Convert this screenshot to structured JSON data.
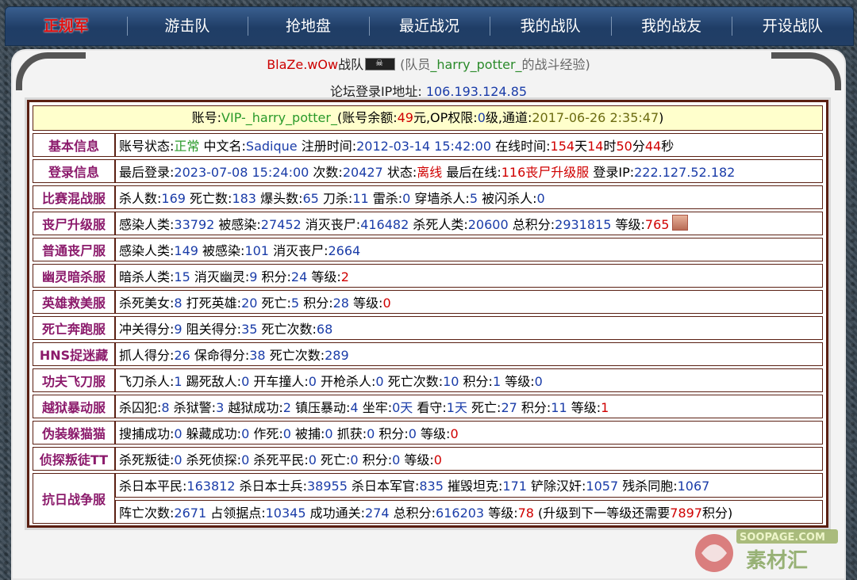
{
  "nav": {
    "items": [
      "正规军",
      "游击队",
      "抢地盘",
      "最近战况",
      "我的战队",
      "我的战友",
      "开设战队"
    ]
  },
  "header": {
    "team": "BlaZe.wOw",
    "team_suffix": "战队",
    "member_prefix": "(队员",
    "member": "_harry_potter_",
    "member_suffix": "的战斗经验)",
    "ip_label": "论坛登录IP地址:",
    "ip": "106.193.124.85"
  },
  "account": {
    "label": "账号:",
    "id": "VIP-_harry_potter_",
    "balance_label": "(账号余额:",
    "balance": "49",
    "balance_unit": "元,OP权限:",
    "op_level": "0",
    "op_unit": "级,通道:",
    "channel": "2017-06-26 2:35:47",
    "close": ")"
  },
  "rows": [
    {
      "label": "基本信息",
      "parts": [
        {
          "t": "账号状态:"
        },
        {
          "t": "正常",
          "c": "g"
        },
        {
          "t": " 中文名:"
        },
        {
          "t": "Sadique",
          "c": "b"
        },
        {
          "t": " 注册时间:"
        },
        {
          "t": "2012-03-14 15:42:00",
          "c": "b"
        },
        {
          "t": " 在线时间:"
        },
        {
          "t": "154",
          "c": "r"
        },
        {
          "t": "天"
        },
        {
          "t": "14",
          "c": "r"
        },
        {
          "t": "时"
        },
        {
          "t": "50",
          "c": "r"
        },
        {
          "t": "分"
        },
        {
          "t": "44",
          "c": "r"
        },
        {
          "t": "秒"
        }
      ]
    },
    {
      "label": "登录信息",
      "parts": [
        {
          "t": "最后登录:"
        },
        {
          "t": "2023-07-08 15:24:00",
          "c": "b"
        },
        {
          "t": " 次数:"
        },
        {
          "t": "20427",
          "c": "b"
        },
        {
          "t": " 状态:"
        },
        {
          "t": "离线",
          "c": "r"
        },
        {
          "t": " 最后在线:"
        },
        {
          "t": "116丧尸升级服",
          "c": "r"
        },
        {
          "t": " 登录IP:"
        },
        {
          "t": "222.127.52.182",
          "c": "b"
        }
      ]
    },
    {
      "label": "比赛混战服",
      "parts": [
        {
          "t": "杀人数:"
        },
        {
          "t": "169",
          "c": "b"
        },
        {
          "t": " 死亡数:"
        },
        {
          "t": "183",
          "c": "b"
        },
        {
          "t": " 爆头数:"
        },
        {
          "t": "65",
          "c": "b"
        },
        {
          "t": " 刀杀:"
        },
        {
          "t": "11",
          "c": "b"
        },
        {
          "t": " 雷杀:"
        },
        {
          "t": "0",
          "c": "b"
        },
        {
          "t": " 穿墙杀人:"
        },
        {
          "t": "5",
          "c": "b"
        },
        {
          "t": " 被闪杀人:"
        },
        {
          "t": "0",
          "c": "b"
        }
      ]
    },
    {
      "label": "丧尸升级服",
      "avatar": true,
      "parts": [
        {
          "t": "感染人类:"
        },
        {
          "t": "33792",
          "c": "b"
        },
        {
          "t": " 被感染:"
        },
        {
          "t": "27452",
          "c": "b"
        },
        {
          "t": " 消灭丧尸:"
        },
        {
          "t": "416482",
          "c": "b"
        },
        {
          "t": " 杀死人类:"
        },
        {
          "t": "20600",
          "c": "b"
        },
        {
          "t": " 总积分:"
        },
        {
          "t": "2931815",
          "c": "b"
        },
        {
          "t": " 等级:"
        },
        {
          "t": "765",
          "c": "r"
        }
      ]
    },
    {
      "label": "普通丧尸服",
      "parts": [
        {
          "t": "感染人类:"
        },
        {
          "t": "149",
          "c": "b"
        },
        {
          "t": " 被感染:"
        },
        {
          "t": "101",
          "c": "b"
        },
        {
          "t": " 消灭丧尸:"
        },
        {
          "t": "2664",
          "c": "b"
        }
      ]
    },
    {
      "label": "幽灵暗杀服",
      "parts": [
        {
          "t": "暗杀人类:"
        },
        {
          "t": "15",
          "c": "b"
        },
        {
          "t": " 消灭幽灵:"
        },
        {
          "t": "9",
          "c": "b"
        },
        {
          "t": " 积分:"
        },
        {
          "t": "24",
          "c": "b"
        },
        {
          "t": " 等级:"
        },
        {
          "t": "2",
          "c": "r"
        }
      ]
    },
    {
      "label": "英雄救美服",
      "parts": [
        {
          "t": "杀死美女:"
        },
        {
          "t": "8",
          "c": "b"
        },
        {
          "t": " 打死英雄:"
        },
        {
          "t": "20",
          "c": "b"
        },
        {
          "t": " 死亡:"
        },
        {
          "t": "5",
          "c": "b"
        },
        {
          "t": " 积分:"
        },
        {
          "t": "28",
          "c": "b"
        },
        {
          "t": " 等级:"
        },
        {
          "t": "0",
          "c": "r"
        }
      ]
    },
    {
      "label": "死亡奔跑服",
      "parts": [
        {
          "t": "冲关得分:"
        },
        {
          "t": "9",
          "c": "b"
        },
        {
          "t": " 阻关得分:"
        },
        {
          "t": "35",
          "c": "b"
        },
        {
          "t": " 死亡次数:"
        },
        {
          "t": "68",
          "c": "b"
        }
      ]
    },
    {
      "label": "HNS捉迷藏",
      "parts": [
        {
          "t": "抓人得分:"
        },
        {
          "t": "26",
          "c": "b"
        },
        {
          "t": " 保命得分:"
        },
        {
          "t": "38",
          "c": "b"
        },
        {
          "t": " 死亡次数:"
        },
        {
          "t": "289",
          "c": "b"
        }
      ]
    },
    {
      "label": "功夫飞刀服",
      "parts": [
        {
          "t": "飞刀杀人:"
        },
        {
          "t": "1",
          "c": "b"
        },
        {
          "t": " 踢死敌人:"
        },
        {
          "t": "0",
          "c": "b"
        },
        {
          "t": " 开车撞人:"
        },
        {
          "t": "0",
          "c": "b"
        },
        {
          "t": " 开枪杀人:"
        },
        {
          "t": "0",
          "c": "b"
        },
        {
          "t": " 死亡次数:"
        },
        {
          "t": "10",
          "c": "b"
        },
        {
          "t": " 积分:"
        },
        {
          "t": "1",
          "c": "b"
        },
        {
          "t": " 等级:"
        },
        {
          "t": "0",
          "c": "b"
        }
      ]
    },
    {
      "label": "越狱暴动服",
      "parts": [
        {
          "t": "杀囚犯:"
        },
        {
          "t": "8",
          "c": "b"
        },
        {
          "t": " 杀狱警:"
        },
        {
          "t": "3",
          "c": "b"
        },
        {
          "t": " 越狱成功:"
        },
        {
          "t": "2",
          "c": "b"
        },
        {
          "t": " 镇压暴动:"
        },
        {
          "t": "4",
          "c": "b"
        },
        {
          "t": " 坐牢:"
        },
        {
          "t": "0天",
          "c": "b"
        },
        {
          "t": " 看守:"
        },
        {
          "t": "1天",
          "c": "b"
        },
        {
          "t": " 死亡:"
        },
        {
          "t": "27",
          "c": "b"
        },
        {
          "t": " 积分:"
        },
        {
          "t": "11",
          "c": "b"
        },
        {
          "t": " 等级:"
        },
        {
          "t": "1",
          "c": "r"
        }
      ]
    },
    {
      "label": "伪装躲猫猫",
      "parts": [
        {
          "t": "搜捕成功:"
        },
        {
          "t": "0",
          "c": "b"
        },
        {
          "t": " 躲藏成功:"
        },
        {
          "t": "0",
          "c": "b"
        },
        {
          "t": " 作死:"
        },
        {
          "t": "0",
          "c": "b"
        },
        {
          "t": " 被捕:"
        },
        {
          "t": "0",
          "c": "b"
        },
        {
          "t": " 抓获:"
        },
        {
          "t": "0",
          "c": "b"
        },
        {
          "t": " 积分:"
        },
        {
          "t": "0",
          "c": "b"
        },
        {
          "t": " 等级:"
        },
        {
          "t": "0",
          "c": "r"
        }
      ]
    },
    {
      "label": "侦探叛徒TT",
      "parts": [
        {
          "t": "杀死叛徒:"
        },
        {
          "t": "0",
          "c": "b"
        },
        {
          "t": " 杀死侦探:"
        },
        {
          "t": "0",
          "c": "b"
        },
        {
          "t": " 杀死平民:"
        },
        {
          "t": "0",
          "c": "b"
        },
        {
          "t": " 死亡:"
        },
        {
          "t": "0",
          "c": "b"
        },
        {
          "t": " 积分:"
        },
        {
          "t": "0",
          "c": "b"
        },
        {
          "t": " 等级:"
        },
        {
          "t": "0",
          "c": "r"
        }
      ]
    }
  ],
  "last_row": {
    "label": "抗日战争服",
    "line1": [
      {
        "t": "杀日本平民:"
      },
      {
        "t": "163812",
        "c": "b"
      },
      {
        "t": " 杀日本士兵:"
      },
      {
        "t": "38955",
        "c": "b"
      },
      {
        "t": " 杀日本军官:"
      },
      {
        "t": "835",
        "c": "b"
      },
      {
        "t": " 摧毁坦克:"
      },
      {
        "t": "171",
        "c": "b"
      },
      {
        "t": " 铲除汉奸:"
      },
      {
        "t": "1057",
        "c": "b"
      },
      {
        "t": " 残杀同胞:"
      },
      {
        "t": "1067",
        "c": "b"
      }
    ],
    "line2": [
      {
        "t": "阵亡次数:"
      },
      {
        "t": "2671",
        "c": "b"
      },
      {
        "t": " 占领据点:"
      },
      {
        "t": "10345",
        "c": "b"
      },
      {
        "t": " 成功通关:"
      },
      {
        "t": "274",
        "c": "b"
      },
      {
        "t": " 总积分:"
      },
      {
        "t": "616203",
        "c": "b"
      },
      {
        "t": " 等级:"
      },
      {
        "t": "78",
        "c": "r"
      },
      {
        "t": " (升级到下一等级还需要"
      },
      {
        "t": "7897",
        "c": "r"
      },
      {
        "t": "积分)"
      }
    ]
  },
  "watermark": {
    "top": "SOOPAGE.COM",
    "bottom": "素材汇"
  }
}
